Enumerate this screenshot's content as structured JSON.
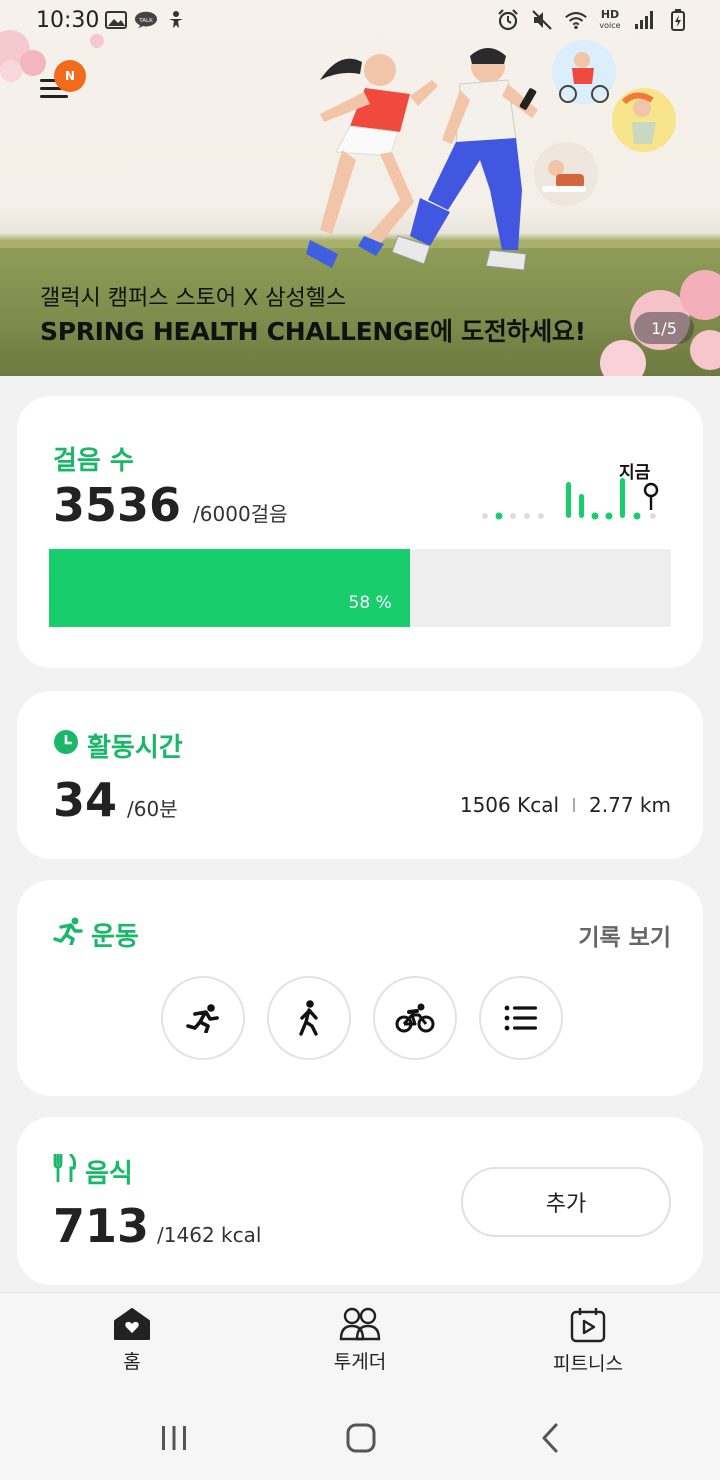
{
  "status_bar": {
    "time": "10:30",
    "left_icons": [
      "image-icon",
      "talk-icon",
      "accessibility-icon"
    ],
    "right_icons": [
      "alarm-icon",
      "mute-icon",
      "wifi-icon",
      "hd-voice-icon",
      "signal-icon",
      "battery-icon"
    ],
    "hd_voice_top": "HD",
    "hd_voice_bottom": "voice"
  },
  "header": {
    "notification_badge": "N"
  },
  "banner": {
    "subtitle": "갤럭시 캠퍼스 스토어 X 삼성헬스",
    "title": "SPRING HEALTH CHALLENGE에 도전하세요!",
    "page_indicator": "1/5"
  },
  "steps": {
    "title": "걸음 수",
    "value": "3536",
    "goal": "/6000걸음",
    "progress_percent": 58,
    "progress_label": "58 %",
    "now_label": "지금",
    "accent": "#17cd6c"
  },
  "active_time": {
    "title": "활동시간",
    "value": "34",
    "goal": "/60분",
    "calories": "1506 Kcal",
    "distance": "2.77 km"
  },
  "exercise": {
    "title": "운동",
    "history_link": "기록 보기",
    "buttons": [
      "running-icon",
      "walking-icon",
      "cycling-icon",
      "list-icon"
    ]
  },
  "food": {
    "title": "음식",
    "value": "713",
    "goal": "/1462 kcal",
    "add_label": "추가"
  },
  "bottom_nav": {
    "items": [
      {
        "label": "홈",
        "icon": "home-icon"
      },
      {
        "label": "투게더",
        "icon": "together-icon"
      },
      {
        "label": "피트니스",
        "icon": "fitness-icon"
      }
    ]
  },
  "colors": {
    "green": "#19b868",
    "progress_green": "#17cd6c",
    "badge_orange": "#f26b1d"
  }
}
